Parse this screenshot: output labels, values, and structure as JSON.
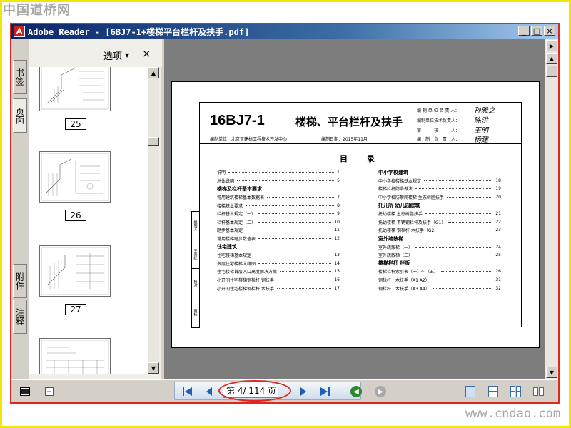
{
  "watermark": {
    "top": "中国道桥网",
    "bottom": "www.cndao.com"
  },
  "window": {
    "title": "Adobe Reader - [6BJ7-1+楼梯平台栏杆及扶手.pdf]",
    "controls": {
      "minimize": "_",
      "restore": "□",
      "close": "×"
    }
  },
  "left_tabs": [
    "书签",
    "页面",
    "附件",
    "注释"
  ],
  "nav_panel": {
    "options_label": "选项",
    "close_glyph": "×",
    "thumbnails": [
      {
        "label": "25"
      },
      {
        "label": "26"
      },
      {
        "label": "27"
      }
    ]
  },
  "document": {
    "code": "16BJ7-1",
    "title": "楼梯、平台栏杆及扶手",
    "compiler": "编制单位：北京首建标工程技术开发中心",
    "date": "编制日期：2015年11月",
    "responsibles": [
      {
        "role": "编 制 单 位 负 责 人：",
        "sign": "孙雅之"
      },
      {
        "role": "编制单位技术负责人：",
        "sign": "陈洪"
      },
      {
        "role": "审　　　核　　　人：",
        "sign": "王明"
      },
      {
        "role": "编　制　负　责　人：",
        "sign": "杨建"
      }
    ],
    "side_strip": [
      "编制人",
      "王美红",
      "校对",
      "审核"
    ],
    "toc_heading": "目　录",
    "toc_left": [
      {
        "text": "说明",
        "page": "1"
      },
      {
        "text": "总体说明",
        "page": "5"
      },
      {
        "text": "楼梯及栏杆基本要求",
        "page": "",
        "heading": true
      },
      {
        "text": "常用建筑楼梯基本数据表",
        "page": "7"
      },
      {
        "text": "楼梯基本要求",
        "page": "8"
      },
      {
        "text": "栏杆基本规定（一）",
        "page": "9"
      },
      {
        "text": "栏杆基本规定（二）",
        "page": "10"
      },
      {
        "text": "踏步基本规定",
        "page": "11"
      },
      {
        "text": "常用楼梯踏步数值表",
        "page": "12"
      },
      {
        "text": "住宅建筑",
        "page": "",
        "heading": true
      },
      {
        "text": "住宅楼梯基本规定",
        "page": "13"
      },
      {
        "text": "多层住宅楼梯大样图",
        "page": "14"
      },
      {
        "text": "住宅楼梯首层入口高度解决方案",
        "page": "15"
      },
      {
        "text": "小开间住宅楼梯钢栏杆 钢扶手",
        "page": "16"
      },
      {
        "text": "小开间住宅楼梯钢栏杆 木扶手",
        "page": "17"
      }
    ],
    "toc_right": [
      {
        "text": "中小学校建筑",
        "page": "",
        "heading": true
      },
      {
        "text": "中小学校楼梯基本规定",
        "page": "18"
      },
      {
        "text": "楼梯栏杆防滑做法",
        "page": "19"
      },
      {
        "text": "中小学校防攀爬楼梯 生态树脂扶手",
        "page": "20"
      },
      {
        "text": "托儿所 幼儿园建筑",
        "page": "",
        "heading": true
      },
      {
        "text": "托幼楼梯 生态树脂扶手",
        "page": "21"
      },
      {
        "text": "托幼楼梯 不锈钢栏杆及扶手（G1）",
        "page": "22"
      },
      {
        "text": "托幼楼梯 钢栏杆 木扶手（G2）",
        "page": "23"
      },
      {
        "text": "室外疏散梯",
        "page": "",
        "heading": true
      },
      {
        "text": "室外疏散梯（一）",
        "page": "24"
      },
      {
        "text": "室外疏散梯（二）",
        "page": "25"
      },
      {
        "text": "楼梯栏杆 栏板",
        "page": "",
        "heading": true
      },
      {
        "text": "楼梯栏杆索引表（一）～（五）",
        "page": "26"
      },
      {
        "text": "钢栏杆　木扶手（A1 A2）",
        "page": "31"
      },
      {
        "text": "钢栏杆　木扶手（A3 A4）",
        "page": "32"
      }
    ]
  },
  "toolbar": {
    "page_indicator": "第 4/ 114 页",
    "current_page": 4,
    "total_pages": 114
  },
  "colors": {
    "highlight_ring": "#e0261f",
    "window_border": "#e0261f",
    "frame": "#f5e600"
  }
}
